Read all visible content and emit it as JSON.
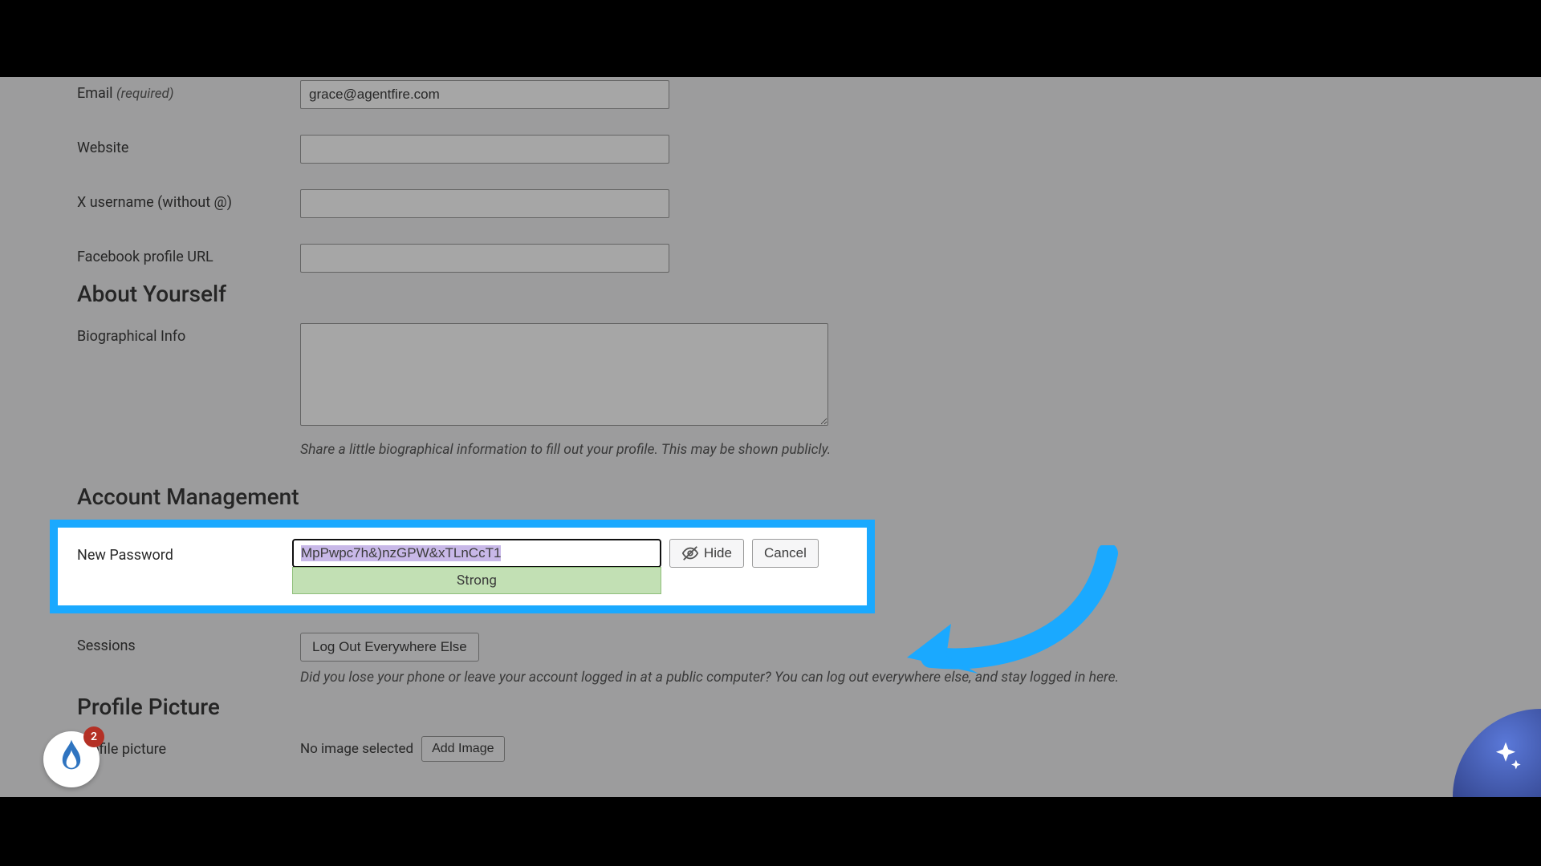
{
  "letterbox": true,
  "fields": {
    "email": {
      "label": "Email",
      "required_label": "(required)",
      "value": "grace@agentfire.com"
    },
    "website": {
      "label": "Website",
      "value": ""
    },
    "x_username": {
      "label": "X username (without @)",
      "value": ""
    },
    "facebook": {
      "label": "Facebook profile URL",
      "value": ""
    }
  },
  "about": {
    "heading": "About Yourself",
    "bio_label": "Biographical Info",
    "bio_value": "",
    "hint": "Share a little biographical information to fill out your profile. This may be shown publicly."
  },
  "account": {
    "heading": "Account Management",
    "new_password_label": "New Password",
    "password_value": "MpPwpc7h&)nzGPW&xTLnCcT1",
    "strength_label": "Strong",
    "hide_label": "Hide",
    "cancel_label": "Cancel",
    "sessions_label": "Sessions",
    "logout_button": "Log Out Everywhere Else",
    "sessions_hint": "Did you lose your phone or leave your account logged in at a public computer? You can log out everywhere else, and stay logged in here."
  },
  "profile_picture": {
    "heading": "Profile Picture",
    "label": "Profile picture",
    "no_image": "No image selected",
    "add_button": "Add Image"
  },
  "widgets": {
    "notification_count": "2"
  },
  "colors": {
    "highlight": "#1aa9ff",
    "strength_bg": "#c2e0b4",
    "badge": "#b43025"
  }
}
